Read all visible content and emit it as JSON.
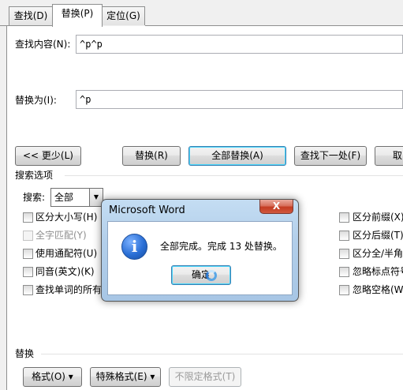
{
  "tabs": [
    {
      "label": "查找(D)",
      "active": false
    },
    {
      "label": "替换(P)",
      "active": true
    },
    {
      "label": "定位(G)",
      "active": false
    }
  ],
  "find": {
    "label": "查找内容(N):",
    "value": "^p^p"
  },
  "replace": {
    "label": "替换为(I):",
    "value": "^p"
  },
  "buttons": {
    "less": "<< 更少(L)",
    "replace": "替换(R)",
    "replace_all": "全部替换(A)",
    "find_next": "查找下一处(F)",
    "cancel": "取"
  },
  "search_options": {
    "heading": "搜索选项",
    "search_label": "搜索:",
    "search_value": "全部",
    "left": [
      {
        "label": "区分大小写(H)",
        "checked": false,
        "disabled": false
      },
      {
        "label": "全字匹配(Y)",
        "checked": false,
        "disabled": true
      },
      {
        "label": "使用通配符(U)",
        "checked": false,
        "disabled": false
      },
      {
        "label": "同音(英文)(K)",
        "checked": false,
        "disabled": false
      },
      {
        "label": "查找单词的所有",
        "checked": false,
        "disabled": false
      }
    ],
    "right": [
      {
        "label": "区分前缀(X)",
        "checked": false,
        "disabled": false
      },
      {
        "label": "区分后缀(T)",
        "checked": false,
        "disabled": false
      },
      {
        "label": "区分全/半角",
        "checked": false,
        "disabled": false
      },
      {
        "label": "忽略标点符号",
        "checked": false,
        "disabled": false
      },
      {
        "label": "忽略空格(W",
        "checked": false,
        "disabled": false
      }
    ]
  },
  "replace_section": {
    "heading": "替换",
    "format": "格式(O) ▾",
    "special": "特殊格式(E) ▾",
    "no_format": "不限定格式(T)"
  },
  "message_box": {
    "title": "Microsoft Word",
    "close": "X",
    "icon": "info-icon",
    "text": "全部完成。完成 13 处替换。",
    "ok": "确定"
  }
}
